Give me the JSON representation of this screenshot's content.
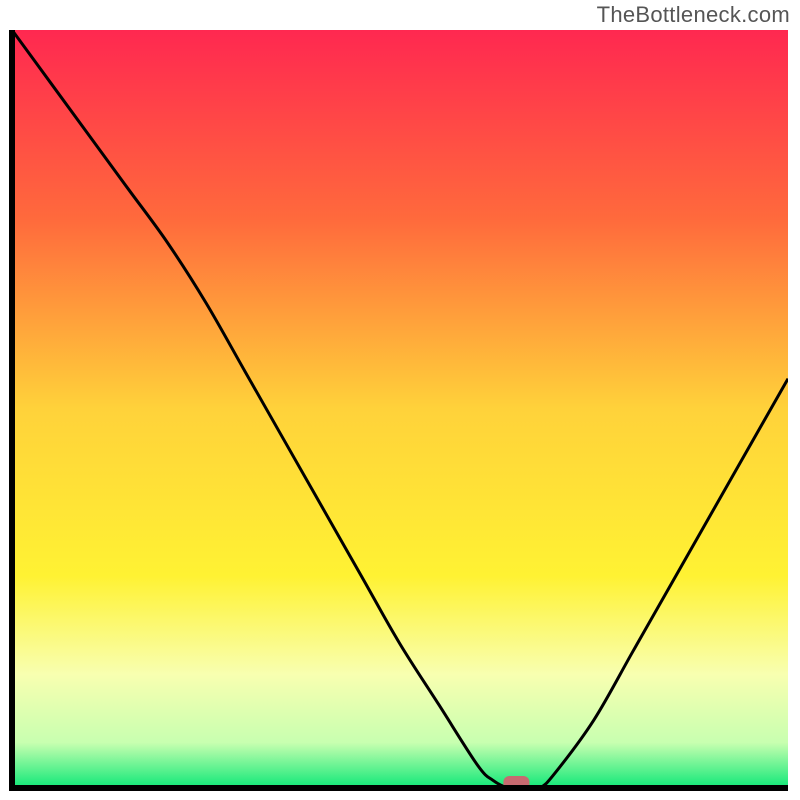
{
  "watermark": "TheBottleneck.com",
  "chart_data": {
    "type": "line",
    "title": "",
    "xlabel": "",
    "ylabel": "",
    "xlim": [
      0,
      100
    ],
    "ylim": [
      0,
      100
    ],
    "grid": false,
    "legend": false,
    "series": [
      {
        "name": "bottleneck-curve",
        "x": [
          0,
          5,
          10,
          15,
          20,
          25,
          30,
          35,
          40,
          45,
          50,
          55,
          60,
          62,
          64,
          66,
          68,
          70,
          75,
          80,
          85,
          90,
          95,
          100
        ],
        "values": [
          100,
          93,
          86,
          79,
          72,
          64,
          55,
          46,
          37,
          28,
          19,
          11,
          3,
          1,
          0,
          0,
          0,
          2,
          9,
          18,
          27,
          36,
          45,
          54
        ]
      }
    ],
    "marker": {
      "name": "selected-point",
      "x": 65,
      "y": 0,
      "color": "#c76a70",
      "shape": "rounded-rect"
    },
    "background_gradient": {
      "stops": [
        {
          "offset": 0.0,
          "color": "#ff2850"
        },
        {
          "offset": 0.25,
          "color": "#ff6a3c"
        },
        {
          "offset": 0.5,
          "color": "#ffd23a"
        },
        {
          "offset": 0.72,
          "color": "#fff233"
        },
        {
          "offset": 0.85,
          "color": "#f8ffb0"
        },
        {
          "offset": 0.94,
          "color": "#c8ffb0"
        },
        {
          "offset": 1.0,
          "color": "#10e878"
        }
      ]
    },
    "frame_color": "#000000",
    "line_color": "#000000",
    "line_width": 3
  }
}
